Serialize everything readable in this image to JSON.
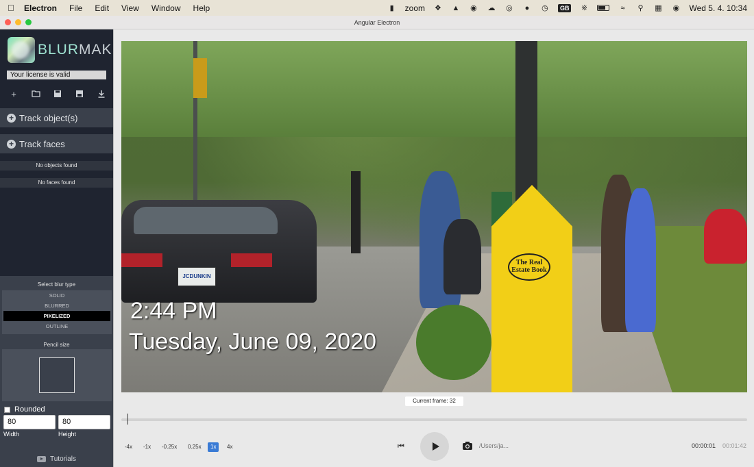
{
  "menubar": {
    "app_name": "Electron",
    "menus": [
      "File",
      "Edit",
      "View",
      "Window",
      "Help"
    ],
    "zoom_label": "zoom",
    "input_source": "GB",
    "datetime": "Wed 5. 4.  10:34"
  },
  "window": {
    "title": "Angular Electron"
  },
  "sidebar": {
    "logo": {
      "brand_a": "BLUR",
      "brand_b": "MAKER"
    },
    "license_text": "Your license is valid",
    "tools": [
      "add-icon",
      "folder-open-icon",
      "save-icon",
      "save-as-icon",
      "download-icon"
    ],
    "track_objects": "Track object(s)",
    "track_faces": "Track faces",
    "no_objects": "No objects found",
    "no_faces": "No faces found",
    "blur_type_title": "Select blur type",
    "blur_types": [
      "SOLID",
      "BLURRED",
      "PIXELIZED",
      "OUTLINE"
    ],
    "blur_selected": "PIXELIZED",
    "pencil_title": "Pencil size",
    "rounded_label": "Rounded",
    "rounded_checked": false,
    "width_value": "80",
    "height_value": "80",
    "width_label": "Width",
    "height_label": "Height",
    "tutorials": "Tutorials"
  },
  "video": {
    "overlay_time": "2:44 PM",
    "overlay_date": "Tuesday, June 09, 2020",
    "plate": "JCDUNKIN",
    "sign_text": "The Real Estate Book"
  },
  "player": {
    "current_frame_label": "Current frame: 32",
    "speeds": [
      "-4x",
      "-1x",
      "-0.25x",
      "0.25x",
      "1x",
      "4x"
    ],
    "speed_selected": "1x",
    "path": "/Users/ja...",
    "time_current": "00:00:01",
    "time_total": "00:01:42"
  }
}
